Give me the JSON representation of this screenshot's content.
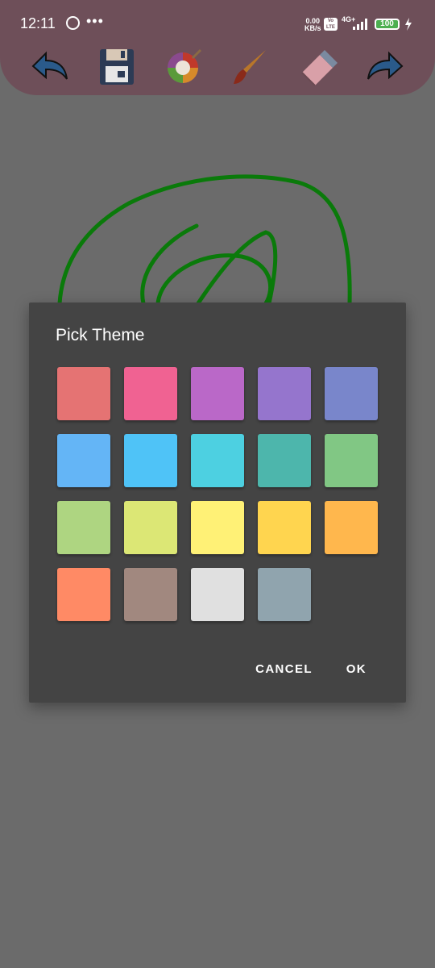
{
  "status_bar": {
    "time": "12:11",
    "net_speed_value": "0.00",
    "net_speed_unit": "KB/s",
    "volte": "Vo LTE",
    "network": "4G+",
    "battery": "100",
    "icons": [
      "whatsapp-icon",
      "more-dots-icon",
      "signal-icon",
      "battery-icon",
      "charging-icon"
    ]
  },
  "toolbar": {
    "items": [
      {
        "name": "undo",
        "icon": "undo-arrow-icon"
      },
      {
        "name": "save",
        "icon": "floppy-disk-icon"
      },
      {
        "name": "color-palette",
        "icon": "palette-icon"
      },
      {
        "name": "brush",
        "icon": "paintbrush-icon"
      },
      {
        "name": "eraser",
        "icon": "eraser-icon"
      },
      {
        "name": "redo",
        "icon": "redo-arrow-icon"
      }
    ],
    "background": "#6e4f59"
  },
  "canvas": {
    "stroke_color": "#0a7a0a"
  },
  "dialog": {
    "title": "Pick Theme",
    "colors": [
      "#e57373",
      "#f06292",
      "#ba68c8",
      "#9575cd",
      "#7986cb",
      "#64b5f6",
      "#4fc3f7",
      "#4dd0e1",
      "#4db6ac",
      "#81c784",
      "#aed581",
      "#dce775",
      "#fff176",
      "#ffd54f",
      "#ffb74d",
      "#ff8a65",
      "#a1887f",
      "#e0e0e0",
      "#90a4ae"
    ],
    "cancel_label": "CANCEL",
    "ok_label": "OK"
  }
}
